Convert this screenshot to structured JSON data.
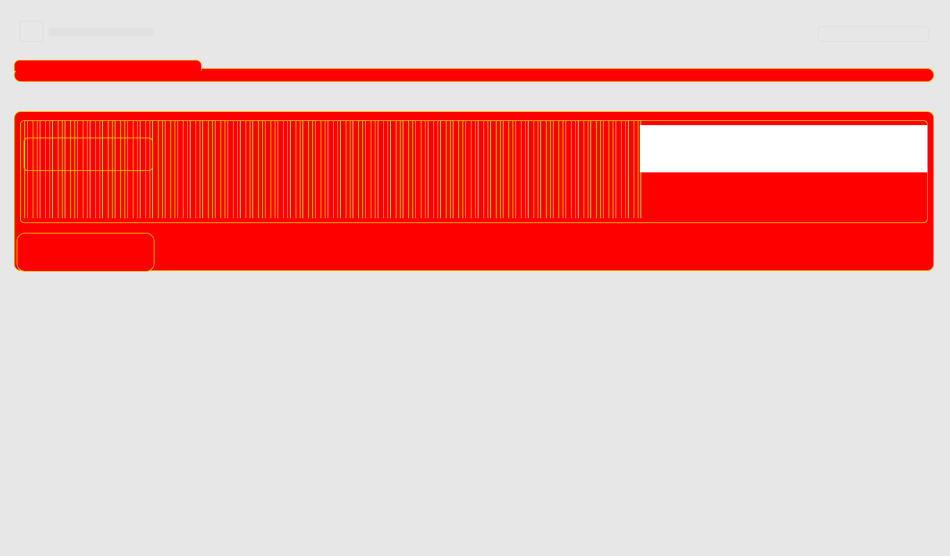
{
  "header": {
    "title": "",
    "action_label": ""
  },
  "tabs": [
    {
      "label": ""
    }
  ],
  "panel": {
    "field_value": "",
    "button_label": ""
  },
  "colors": {
    "background": "#e7e7e7",
    "panel": "#ff0000",
    "accent": "#f5d000"
  }
}
